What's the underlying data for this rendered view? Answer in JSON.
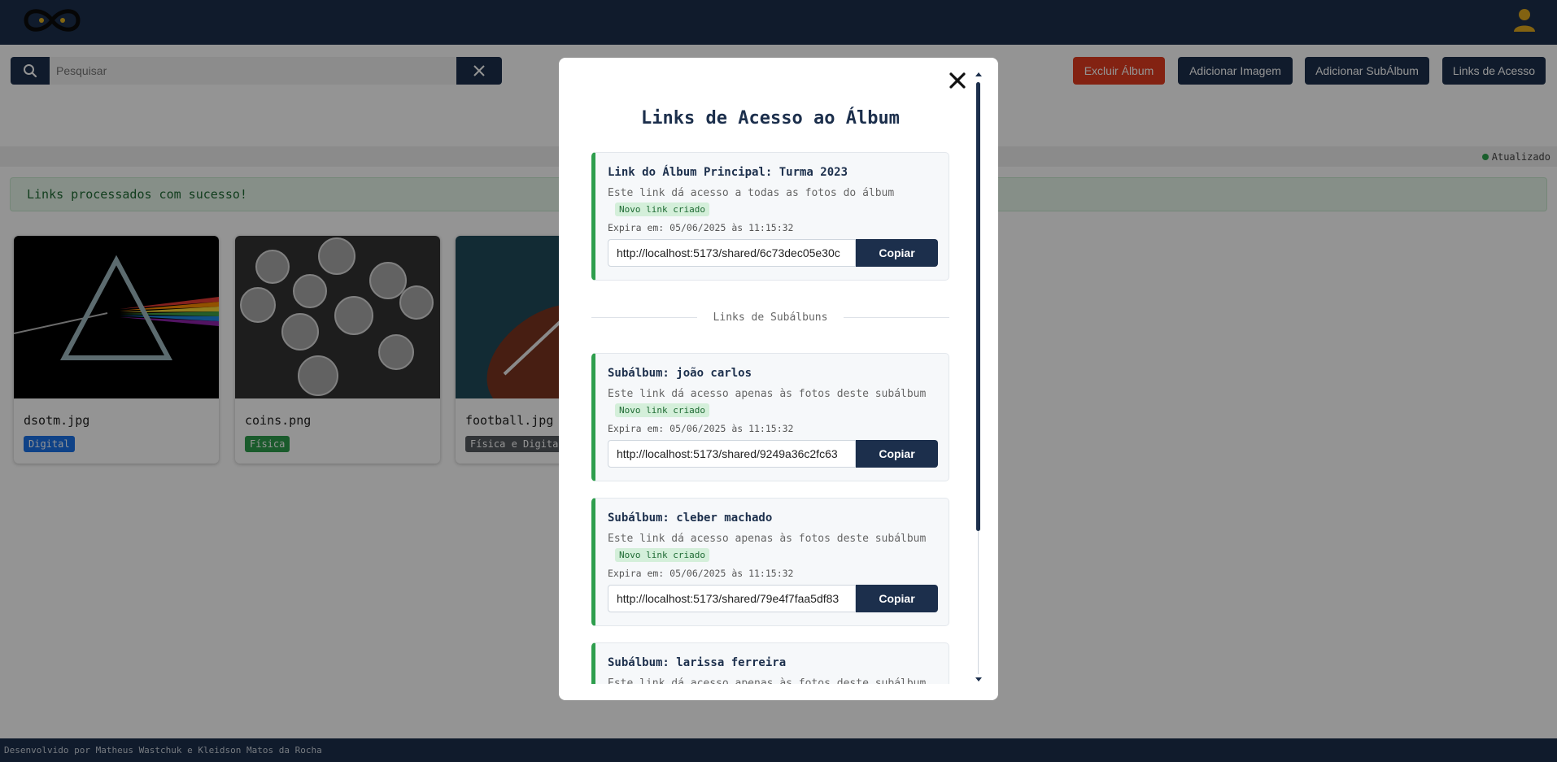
{
  "header": {
    "logo_icon": "infinity-logo-icon",
    "user_icon": "user-icon"
  },
  "search": {
    "placeholder": "Pesquisar",
    "value": ""
  },
  "toolbar": {
    "delete_album": "Excluir Álbum",
    "add_image": "Adicionar Imagem",
    "add_subalbum": "Adicionar SubÁlbum",
    "access_links": "Links de Acesso"
  },
  "status": {
    "label": "Atualizado"
  },
  "alert": {
    "message": "Links processados com sucesso!"
  },
  "images": [
    {
      "name": "dsotm.jpg",
      "tag": "Digital",
      "tag_color": "#1a73e8"
    },
    {
      "name": "coins.png",
      "tag": "Física",
      "tag_color": "#2e9e4d"
    },
    {
      "name": "football.jpg",
      "tag": "Física e Digital",
      "tag_color": "#555a60"
    }
  ],
  "modal": {
    "title": "Links de Acesso ao Álbum",
    "main_link": {
      "title": "Link do Álbum Principal: Turma 2023",
      "description": "Este link dá acesso a todas as fotos do álbum",
      "badge": "Novo link criado",
      "expires": "Expira em: 05/06/2025 às 11:15:32",
      "url": "http://localhost:5173/shared/6c73dec05e30c",
      "copy_label": "Copiar"
    },
    "subalbums_divider": "Links de Subálbuns",
    "subalbums": [
      {
        "title": "Subálbum: joão carlos",
        "description": "Este link dá acesso apenas às fotos deste subálbum",
        "badge": "Novo link criado",
        "expires": "Expira em: 05/06/2025 às 11:15:32",
        "url": "http://localhost:5173/shared/9249a36c2fc63",
        "copy_label": "Copiar"
      },
      {
        "title": "Subálbum: cleber machado",
        "description": "Este link dá acesso apenas às fotos deste subálbum",
        "badge": "Novo link criado",
        "expires": "Expira em: 05/06/2025 às 11:15:32",
        "url": "http://localhost:5173/shared/79e4f7faa5df83",
        "copy_label": "Copiar"
      },
      {
        "title": "Subálbum: larissa ferreira",
        "description": "Este link dá acesso apenas às fotos deste subálbum"
      }
    ]
  },
  "footer": {
    "text": "Desenvolvido por Matheus Wastchuk e Kleidson Matos da Rocha"
  }
}
